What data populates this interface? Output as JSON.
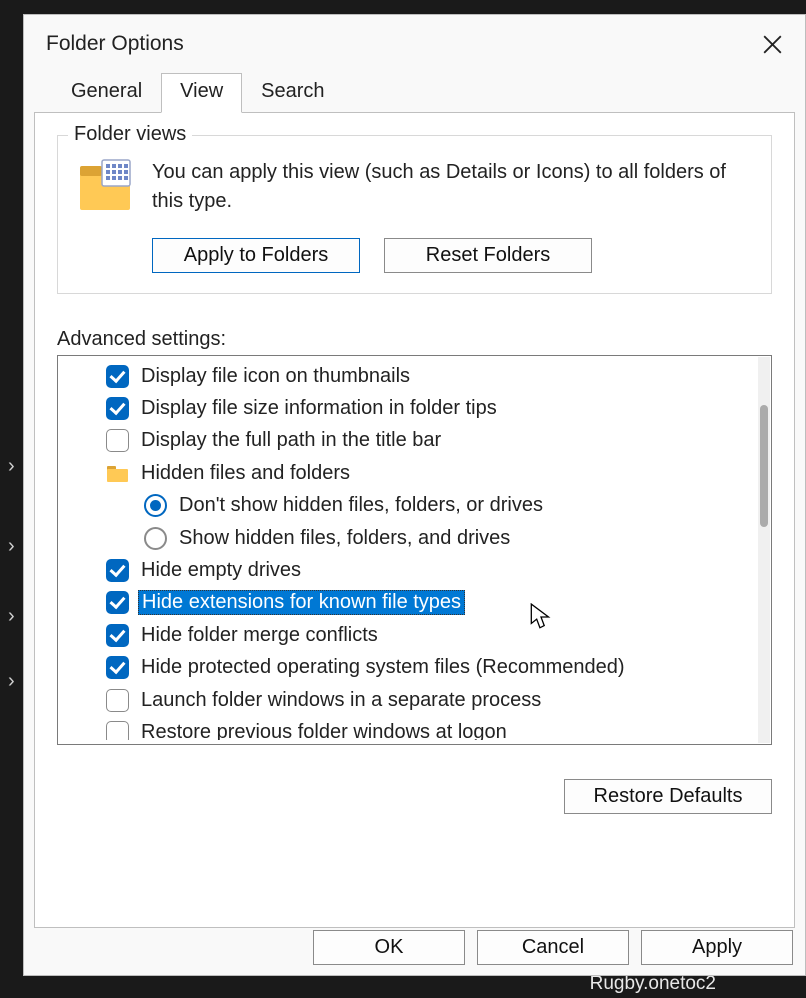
{
  "window": {
    "title": "Folder Options"
  },
  "tabs": {
    "general": "General",
    "view": "View",
    "search": "Search",
    "active": "view"
  },
  "folder_views": {
    "legend": "Folder views",
    "description": "You can apply this view (such as Details or Icons) to all folders of this type.",
    "apply_btn": "Apply to Folders",
    "reset_btn": "Reset Folders"
  },
  "advanced": {
    "label": "Advanced settings:",
    "items": [
      {
        "type": "checkbox",
        "checked": true,
        "label": "Display file icon on thumbnails",
        "selected": false
      },
      {
        "type": "checkbox",
        "checked": true,
        "label": "Display file size information in folder tips",
        "selected": false
      },
      {
        "type": "checkbox",
        "checked": false,
        "label": "Display the full path in the title bar",
        "selected": false
      },
      {
        "type": "folder",
        "label": "Hidden files and folders",
        "selected": false
      },
      {
        "type": "radio",
        "checked": true,
        "label": "Don't show hidden files, folders, or drives",
        "selected": false
      },
      {
        "type": "radio",
        "checked": false,
        "label": "Show hidden files, folders, and drives",
        "selected": false
      },
      {
        "type": "checkbox",
        "checked": true,
        "label": "Hide empty drives",
        "selected": false
      },
      {
        "type": "checkbox",
        "checked": true,
        "label": "Hide extensions for known file types",
        "selected": true
      },
      {
        "type": "checkbox",
        "checked": true,
        "label": "Hide folder merge conflicts",
        "selected": false
      },
      {
        "type": "checkbox",
        "checked": true,
        "label": "Hide protected operating system files (Recommended)",
        "selected": false
      },
      {
        "type": "checkbox",
        "checked": false,
        "label": "Launch folder windows in a separate process",
        "selected": false
      },
      {
        "type": "checkbox",
        "checked": false,
        "label": "Restore previous folder windows at logon",
        "selected": false
      }
    ]
  },
  "restore_defaults": "Restore Defaults",
  "footer": {
    "ok": "OK",
    "cancel": "Cancel",
    "apply": "Apply"
  },
  "background": {
    "file": "Rugby.onetoc2"
  }
}
